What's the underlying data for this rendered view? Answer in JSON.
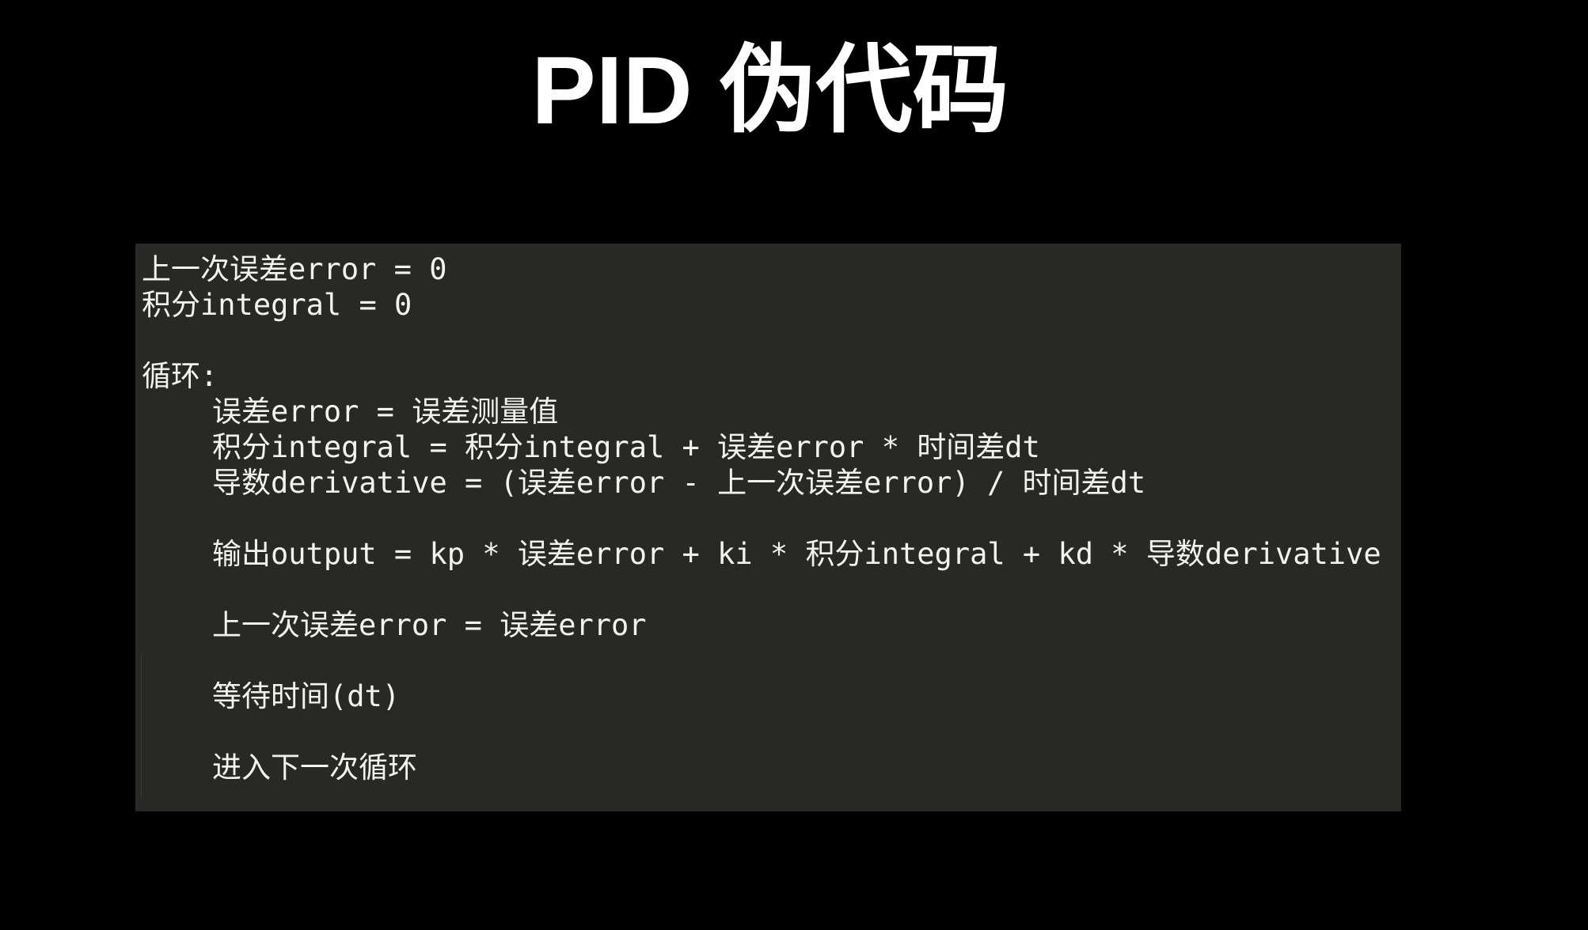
{
  "slide": {
    "title": "PID 伪代码"
  },
  "code": {
    "line_prev_error_init": "上一次误差error = 0",
    "line_integral_init": "积分integral = 0",
    "line_loop": "循环:",
    "line_error": "误差error = 误差测量值",
    "line_integral": "积分integral = 积分integral + 误差error * 时间差dt",
    "line_derivative": "导数derivative = (误差error - 上一次误差error) / 时间差dt",
    "line_output": "输出output = kp * 误差error + ki * 积分integral + kd * 导数derivative",
    "line_prev_error_update": "上一次误差error = 误差error",
    "line_wait": "等待时间(dt)",
    "line_next": "进入下一次循环"
  },
  "colors": {
    "background": "#000000",
    "panel": "#282824",
    "text": "#f2f2f2",
    "title": "#ffffff"
  }
}
